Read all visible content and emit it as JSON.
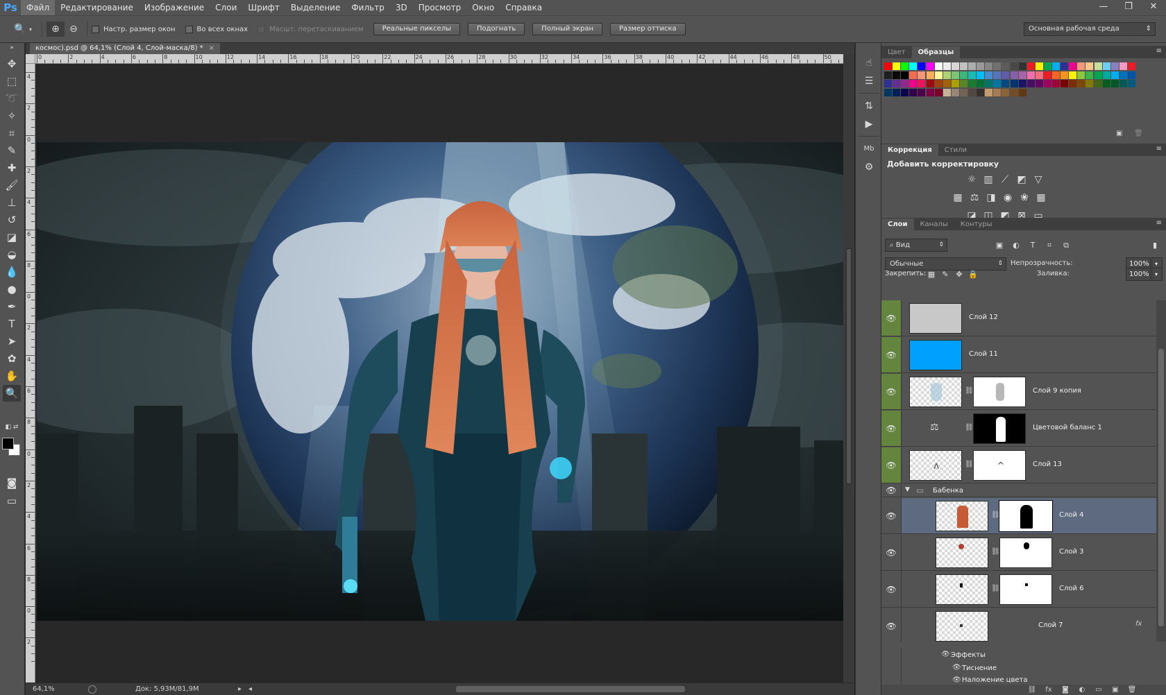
{
  "app": {
    "logo": "Ps"
  },
  "menu": [
    "Файл",
    "Редактирование",
    "Изображение",
    "Слои",
    "Шрифт",
    "Выделение",
    "Фильтр",
    "3D",
    "Просмотр",
    "Окно",
    "Справка"
  ],
  "window_controls": {
    "minimize": "—",
    "restore": "❐",
    "close": "✕"
  },
  "options": {
    "tool_icon": "🔍",
    "zoom_in_icon": "⊕",
    "zoom_out_icon": "⊖",
    "checkboxes": [
      "Настр. размер окон",
      "Во всех окнах",
      "Масшт. перетаскиванием"
    ],
    "buttons": [
      "Реальные пикселы",
      "Подогнать",
      "Полный экран",
      "Размер оттиска"
    ],
    "workspace": "Основная рабочая среда"
  },
  "document": {
    "tab_title": "космос).psd @ 64,1% (Слой 4, Слой-маска/8) *",
    "tab_close": "×",
    "ruler_h_labels": [
      "0",
      "2",
      "4",
      "6",
      "8",
      "10",
      "12",
      "14",
      "16",
      "18",
      "20",
      "22",
      "24",
      "26",
      "28",
      "30",
      "32",
      "34",
      "36",
      "38",
      "40",
      "42",
      "44",
      "46",
      "48",
      "50"
    ],
    "ruler_v_labels": [
      "4",
      "2",
      "0",
      "2",
      "4",
      "6",
      "8",
      "0",
      "2",
      "4",
      "6",
      "8",
      "0",
      "2",
      "4",
      "6",
      "8",
      "0",
      "2"
    ]
  },
  "status": {
    "zoom": "64,1%",
    "doc_info": "Док: 5,93М/81,9М"
  },
  "colors": {
    "foreground": "#000000",
    "background": "#ffffff"
  },
  "tools": [
    "move-icon",
    "marquee-icon",
    "lasso-icon",
    "quick-select-icon",
    "crop-icon",
    "eyedropper-icon",
    "healing-icon",
    "brush-icon",
    "stamp-icon",
    "history-brush-icon",
    "eraser-icon",
    "bucket-icon",
    "blur-icon",
    "dodge-icon",
    "pen-icon",
    "type-icon",
    "path-select-icon",
    "shape-icon",
    "hand-icon",
    "zoom-icon"
  ],
  "panels": {
    "swatches_tabs": [
      "Цвет",
      "Образцы"
    ],
    "adjust_tabs": [
      "Коррекция",
      "Стили"
    ],
    "adjust_title": "Добавить корректировку",
    "layers_tabs": [
      "Слои",
      "Каналы",
      "Контуры"
    ]
  },
  "layers_panel": {
    "filter_kind": "Вид",
    "blend_mode": "Обычные",
    "opacity_label": "Непрозрачность:",
    "opacity": "100%",
    "lock_label": "Закрепить:",
    "fill_label": "Заливка:",
    "fill": "100%",
    "layers": [
      {
        "name": "Слой 12",
        "thumb_color": "#c8c8c8"
      },
      {
        "name": "Слой 11",
        "thumb_color": "#00a0ff"
      },
      {
        "name": "Слой 9 копия"
      },
      {
        "name": "Цветовой баланс 1"
      },
      {
        "name": "Слой 13"
      },
      {
        "name": "Бабенка"
      },
      {
        "name": "Слой 4"
      },
      {
        "name": "Слой 3"
      },
      {
        "name": "Слой 6"
      },
      {
        "name": "Слой 7"
      }
    ],
    "effects_label": "Эффекты",
    "effects": [
      "Тиснение",
      "Наложение цвета"
    ],
    "fx_label": "fx"
  }
}
